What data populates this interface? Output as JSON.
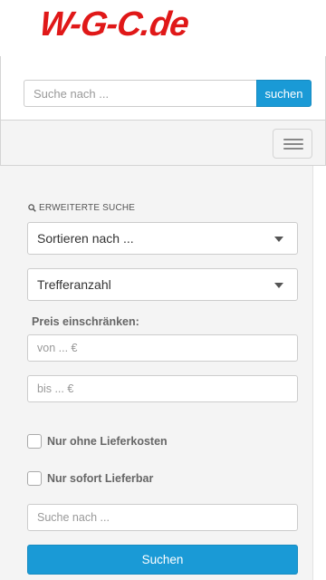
{
  "header": {
    "logo": "W-G-C.de",
    "search": {
      "placeholder": "Suche nach ...",
      "button_label": "suchen"
    }
  },
  "navbar": {
    "toggle_icon": "hamburger-menu-icon"
  },
  "filters": {
    "title": "ERWEITERTE SUCHE",
    "title_icon": "search-icon",
    "sort_select": {
      "value": "Sortieren nach ..."
    },
    "results_select": {
      "value": "Trefferanzahl"
    },
    "price_label": "Preis einschränken:",
    "price_from": {
      "placeholder": "von ... €"
    },
    "price_to": {
      "placeholder": "bis ... €"
    },
    "checkboxes": [
      {
        "label": "Nur ohne Lieferkosten",
        "checked": false
      },
      {
        "label": "Nur sofort Lieferbar",
        "checked": false
      }
    ],
    "search": {
      "placeholder": "Suche nach ..."
    },
    "submit_label": "Suchen"
  },
  "colors": {
    "accent": "#1a9ad6",
    "logo": "#e01818",
    "panel_bg": "#f4f4f4"
  }
}
